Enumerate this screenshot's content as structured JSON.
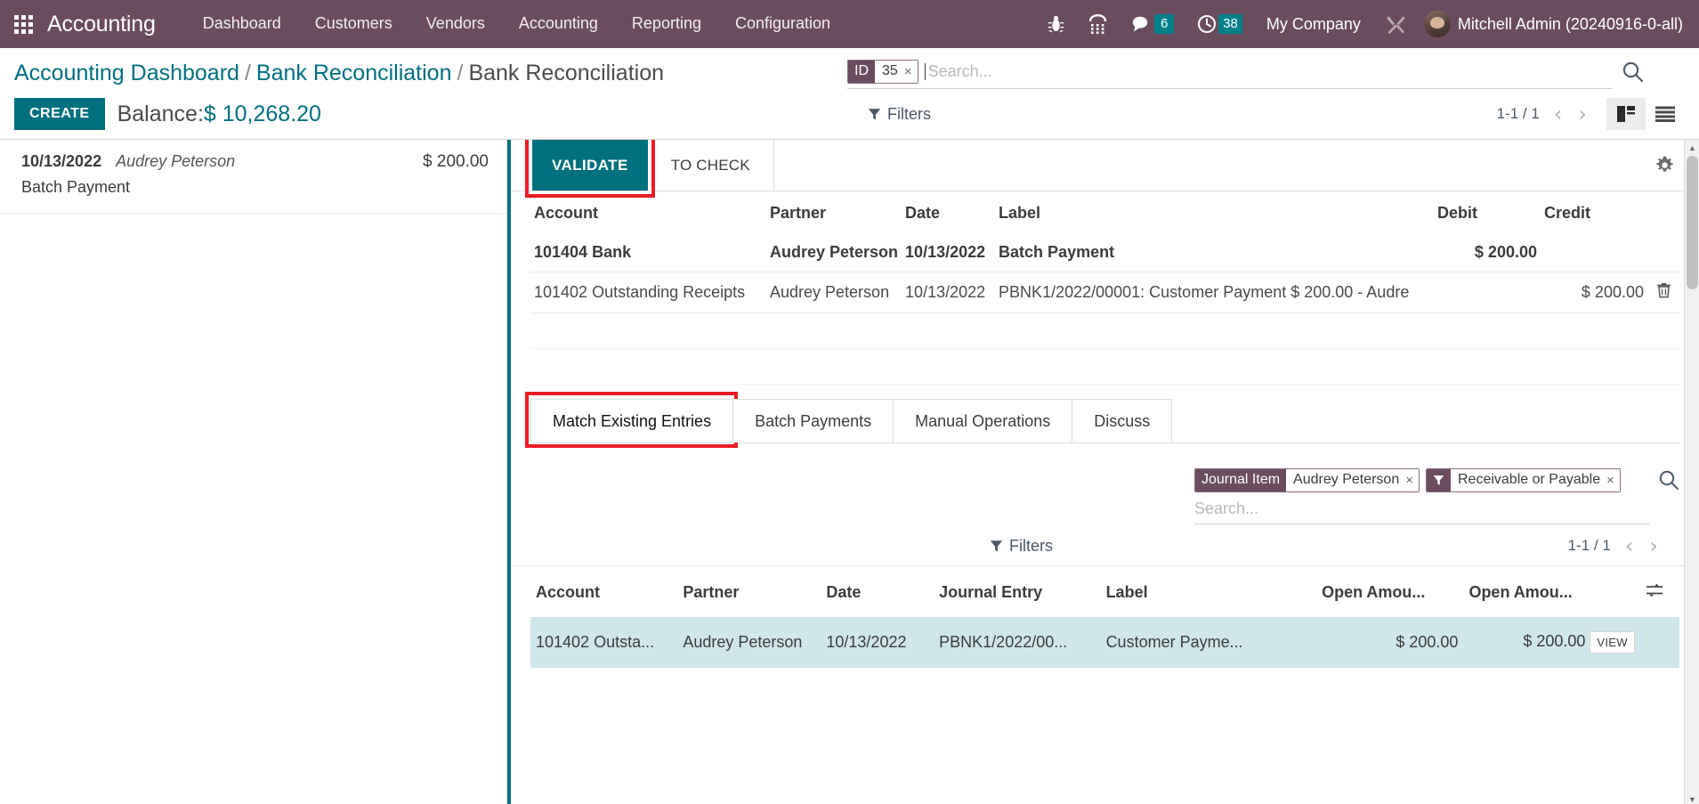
{
  "navbar": {
    "apps_icon": "apps-grid-icon",
    "brand": "Accounting",
    "menu": [
      {
        "label": "Dashboard"
      },
      {
        "label": "Customers"
      },
      {
        "label": "Vendors"
      },
      {
        "label": "Accounting"
      },
      {
        "label": "Reporting"
      },
      {
        "label": "Configuration"
      }
    ],
    "icons": [
      {
        "name": "bug-icon"
      },
      {
        "name": "dialpad-icon"
      },
      {
        "name": "messages-icon",
        "badge": "6"
      },
      {
        "name": "activities-clock-icon",
        "badge": "38"
      }
    ],
    "company": "My Company",
    "tools_icon": "wrench-screwdriver-icon",
    "user": "Mitchell Admin (20240916-0-all)",
    "bg_color": "#6b4c5f",
    "badge_color": "#00818a"
  },
  "control_panel": {
    "breadcrumb": [
      {
        "label": "Accounting Dashboard",
        "link": true
      },
      {
        "label": "Bank Reconciliation",
        "link": true
      },
      {
        "label": "Bank Reconciliation",
        "link": false
      }
    ],
    "separator": "/",
    "create_label": "CREATE",
    "balance_label": "Balance:",
    "balance_amount": "$ 10,268.20",
    "filters_label": "Filters",
    "pager": "1-1 / 1",
    "prev_icon": "chevron-left-icon",
    "next_icon": "chevron-right-icon",
    "view_kanban_icon": "reconciliation-view-icon",
    "view_list_icon": "list-view-icon",
    "accent_color": "#00707f"
  },
  "search": {
    "facet": {
      "label": "ID",
      "value": "35",
      "remove": "×"
    },
    "placeholder": "Search...",
    "value": "",
    "search_icon": "magnifier-icon"
  },
  "statement_lines": [
    {
      "date": "10/13/2022",
      "partner": "Audrey Peterson",
      "amount": "$ 200.00",
      "label": "Batch Payment"
    }
  ],
  "recon_toolbar": {
    "validate_label": "VALIDATE",
    "to_check_label": "TO CHECK",
    "gear_icon": "gear-icon",
    "validate_highlight_color": "#ec1c24"
  },
  "recon_table": {
    "headers": {
      "account": "Account",
      "partner": "Partner",
      "date": "Date",
      "label": "Label",
      "debit": "Debit",
      "credit": "Credit"
    },
    "rows": [
      {
        "account": "101404 Bank",
        "partner": "Audrey Peterson",
        "date": "10/13/2022",
        "label": "Batch Payment",
        "debit": "$ 200.00",
        "credit": "",
        "bold": true,
        "trash": ""
      },
      {
        "account": "101402 Outstanding Receipts",
        "partner": "Audrey Peterson",
        "date": "10/13/2022",
        "label": "PBNK1/2022/00001: Customer Payment $ 200.00 - Audre",
        "debit": "",
        "credit": "$ 200.00",
        "bold": false,
        "trash": "trash-icon"
      }
    ]
  },
  "notebook": {
    "tabs": [
      {
        "label": "Match Existing Entries",
        "active": true,
        "highlighted": true
      },
      {
        "label": "Batch Payments",
        "active": false,
        "highlighted": false
      },
      {
        "label": "Manual Operations",
        "active": false,
        "highlighted": false
      },
      {
        "label": "Discuss",
        "active": false,
        "highlighted": false
      }
    ],
    "tab_highlight_color": "#ec1c24"
  },
  "inner_search": {
    "facets": [
      {
        "label": "Journal Item",
        "value": "Audrey Peterson",
        "remove": "×",
        "type": "field"
      },
      {
        "label": "",
        "value": "Receivable or Payable",
        "value_italic_word": "or",
        "remove": "×",
        "type": "filter",
        "icon": "funnel-icon"
      }
    ],
    "placeholder": "Search...",
    "search_icon": "magnifier-icon",
    "filters_label": "Filters",
    "pager": "1-1 / 1",
    "prev_icon": "chevron-left-icon",
    "next_icon": "chevron-right-icon"
  },
  "move_lines": {
    "headers": [
      "Account",
      "Partner",
      "Date",
      "Journal Entry",
      "Label",
      "Open Amou...",
      "Open Amou..."
    ],
    "optional_columns_icon": "column-options-icon",
    "rows": [
      {
        "account": "101402 Outsta...",
        "partner": "Audrey Peterson",
        "date": "10/13/2022",
        "journal_entry": "PBNK1/2022/00...",
        "label": "Customer Payme...",
        "open_amount_1": "$ 200.00",
        "open_amount_2": "$ 200.00",
        "view_label": "VIEW",
        "selected": true
      }
    ],
    "selected_row_color": "#cfe7ea"
  }
}
